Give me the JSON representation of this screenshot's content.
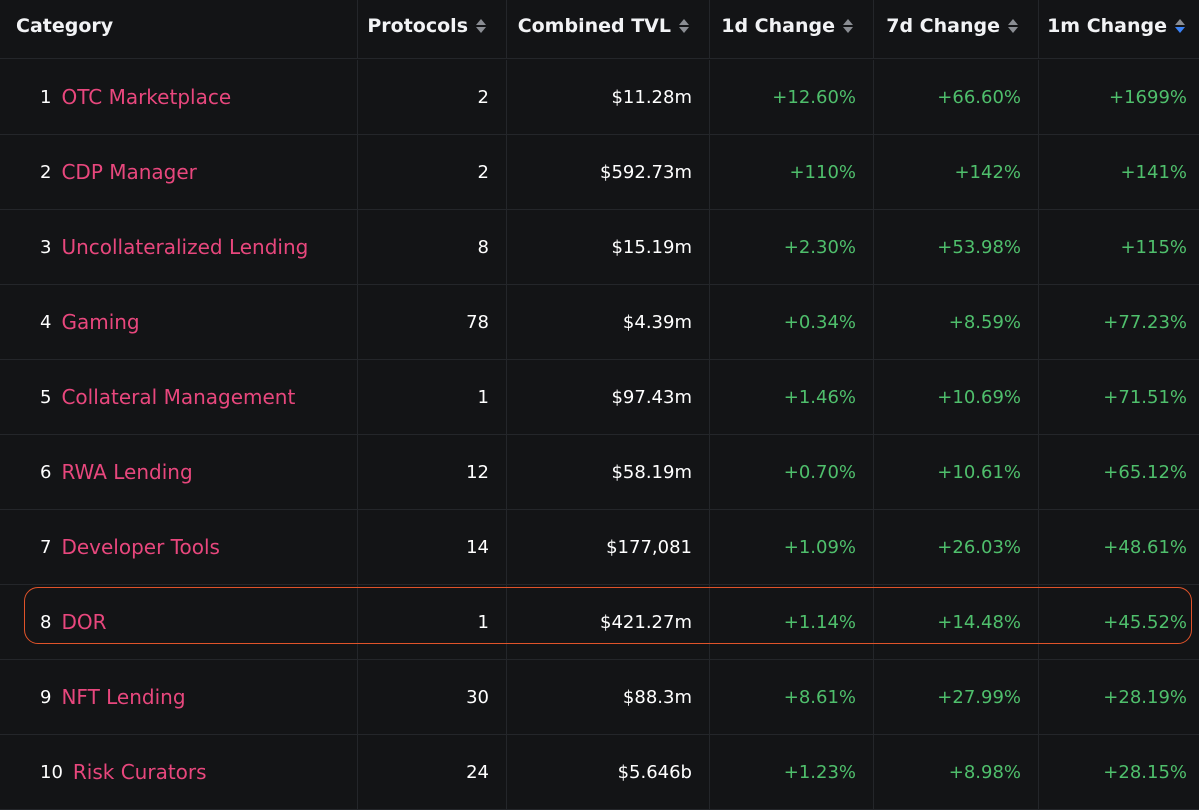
{
  "header": {
    "category": "Category",
    "protocols": "Protocols",
    "combined_tvl": "Combined TVL",
    "change_1d": "1d Change",
    "change_7d": "7d Change",
    "change_1m": "1m Change",
    "sort_active_column": "1m Change",
    "sort_direction": "descending"
  },
  "colors": {
    "category_link": "#e8477d",
    "positive_change": "#4fbf6c",
    "highlight_border": "#e0532a",
    "active_sort": "#3b82f6",
    "background": "#131416"
  },
  "icons": {
    "sort": "sort-arrows-icon"
  },
  "rows": [
    {
      "rank": "1",
      "category": "OTC Marketplace",
      "protocols": "2",
      "tvl": "$11.28m",
      "d1": "+12.60%",
      "d7": "+66.60%",
      "m1": "+1699%"
    },
    {
      "rank": "2",
      "category": "CDP Manager",
      "protocols": "2",
      "tvl": "$592.73m",
      "d1": "+110%",
      "d7": "+142%",
      "m1": "+141%"
    },
    {
      "rank": "3",
      "category": "Uncollateralized Lending",
      "protocols": "8",
      "tvl": "$15.19m",
      "d1": "+2.30%",
      "d7": "+53.98%",
      "m1": "+115%"
    },
    {
      "rank": "4",
      "category": "Gaming",
      "protocols": "78",
      "tvl": "$4.39m",
      "d1": "+0.34%",
      "d7": "+8.59%",
      "m1": "+77.23%"
    },
    {
      "rank": "5",
      "category": "Collateral Management",
      "protocols": "1",
      "tvl": "$97.43m",
      "d1": "+1.46%",
      "d7": "+10.69%",
      "m1": "+71.51%"
    },
    {
      "rank": "6",
      "category": "RWA Lending",
      "protocols": "12",
      "tvl": "$58.19m",
      "d1": "+0.70%",
      "d7": "+10.61%",
      "m1": "+65.12%"
    },
    {
      "rank": "7",
      "category": "Developer Tools",
      "protocols": "14",
      "tvl": "$177,081",
      "d1": "+1.09%",
      "d7": "+26.03%",
      "m1": "+48.61%"
    },
    {
      "rank": "8",
      "category": "DOR",
      "protocols": "1",
      "tvl": "$421.27m",
      "d1": "+1.14%",
      "d7": "+14.48%",
      "m1": "+45.52%",
      "highlighted": true
    },
    {
      "rank": "9",
      "category": "NFT Lending",
      "protocols": "30",
      "tvl": "$88.3m",
      "d1": "+8.61%",
      "d7": "+27.99%",
      "m1": "+28.19%"
    },
    {
      "rank": "10",
      "category": "Risk Curators",
      "protocols": "24",
      "tvl": "$5.646b",
      "d1": "+1.23%",
      "d7": "+8.98%",
      "m1": "+28.15%"
    }
  ]
}
